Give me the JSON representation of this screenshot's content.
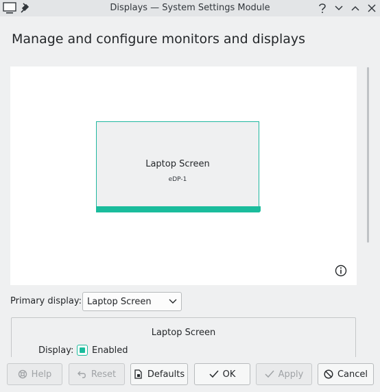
{
  "titlebar": {
    "title": "Displays — System Settings Module",
    "app_icon": "monitor-icon",
    "buttons": [
      "help-icon",
      "minimize-icon",
      "maximize-icon",
      "close-icon"
    ]
  },
  "heading": "Manage and configure monitors and displays",
  "preview": {
    "monitor": {
      "name": "Laptop Screen",
      "connector": "eDP-1"
    },
    "info_icon": "info-icon"
  },
  "primary": {
    "label": "Primary display:",
    "selected": "Laptop Screen"
  },
  "output": {
    "title": "Laptop Screen",
    "display_label": "Display:",
    "enabled_label": "Enabled",
    "enabled": true
  },
  "buttons": {
    "help": "Help",
    "reset": "Reset",
    "defaults": "Defaults",
    "ok": "OK",
    "apply": "Apply",
    "cancel": "Cancel"
  },
  "colors": {
    "accent": "#1abc9c",
    "window_bg": "#eff0f1",
    "preview_bg": "#ffffff"
  }
}
